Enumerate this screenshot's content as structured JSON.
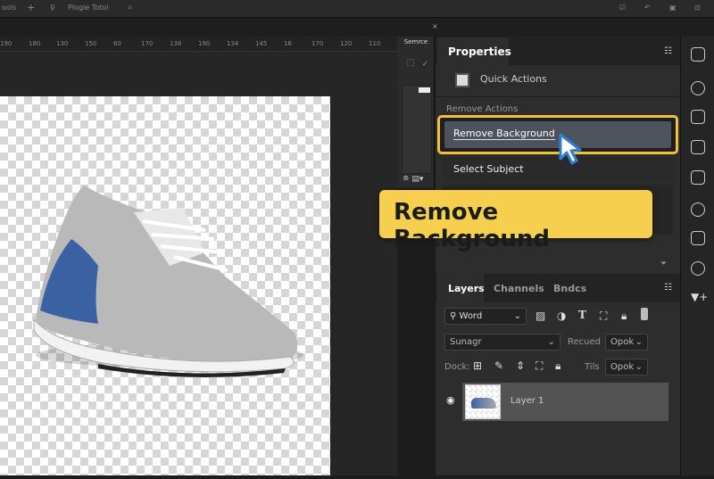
{
  "topbar": {
    "left_label": "ools",
    "plugin_label": "Plogie Totol"
  },
  "ruler": {
    "ticks": [
      "190",
      "180",
      "130",
      "150",
      "60",
      "170",
      "138",
      "190",
      "134",
      "145",
      "16",
      "170",
      "120",
      "110"
    ]
  },
  "toolstrip": {
    "title": "Semrce"
  },
  "properties": {
    "tab": "Properties",
    "quick_actions": "Quick Actions",
    "section": "Remove Actions",
    "remove_background": "Remove Background",
    "select_subject": "Select Subject"
  },
  "callout": {
    "text": "Remove Background"
  },
  "layers": {
    "tabs": [
      "Layers",
      "Channels",
      "Bndcs"
    ],
    "filter": "Word",
    "blend_mode": "Sunagr",
    "opacity_label": "Recued",
    "opacity_value": "Opok",
    "lock_label": "Dock:",
    "fill_label": "Tils",
    "fill_value": "Opok",
    "layer_name": "Layer 1"
  },
  "colors": {
    "accent": "#f0c13a",
    "callout_bg": "#f6cf4f",
    "selection": "#4d535c"
  }
}
